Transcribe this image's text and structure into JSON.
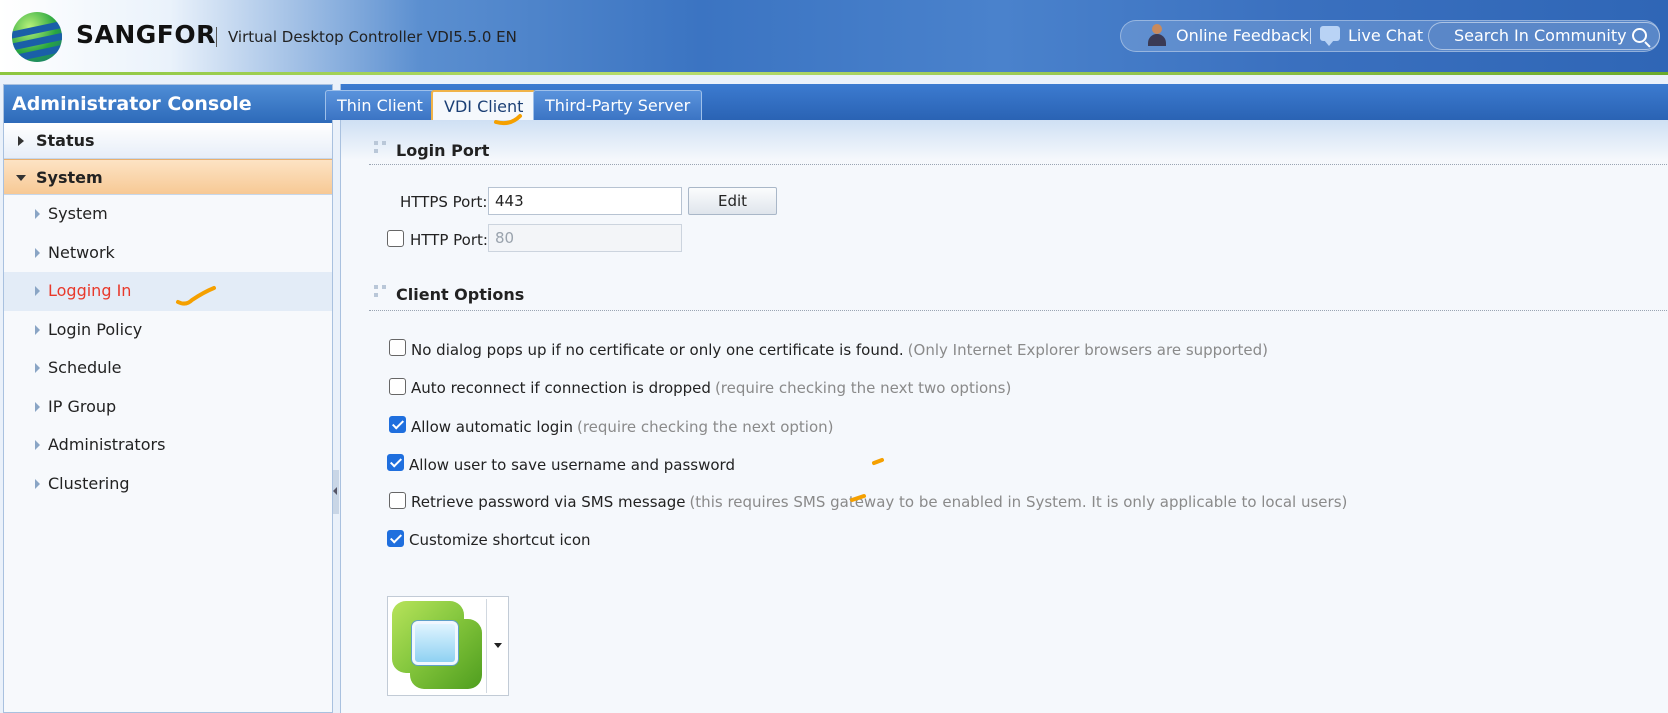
{
  "header": {
    "brand": "SANGFOR",
    "product": "Virtual Desktop Controller VDI5.5.0 EN",
    "links": {
      "online_feedback": "Online Feedback",
      "live_chat": "Live Chat",
      "search_community": "Search In Community"
    }
  },
  "sidebar": {
    "title": "Administrator Console",
    "sections": {
      "status": "Status",
      "system": "System"
    },
    "items": [
      "System",
      "Network",
      "Logging In",
      "Login Policy",
      "Schedule",
      "IP Group",
      "Administrators",
      "Clustering"
    ],
    "active_item": "Logging In"
  },
  "tabs": [
    "Thin Client",
    "VDI Client",
    "Third-Party Server"
  ],
  "active_tab": "VDI Client",
  "login_port": {
    "title": "Login Port",
    "https_label": "HTTPS Port:",
    "https_value": "443",
    "edit_label": "Edit",
    "http_label": "HTTP Port:",
    "http_value": "80",
    "http_checked": false
  },
  "client_options": {
    "title": "Client Options",
    "options": [
      {
        "label": "No dialog pops up if no certificate or only one certificate is found.",
        "hint": "(Only Internet Explorer browsers are supported)",
        "checked": false
      },
      {
        "label": "Auto reconnect if connection is dropped",
        "hint": "(require checking the next two options)",
        "checked": false
      },
      {
        "label": "Allow automatic login",
        "hint": "(require checking the next option)",
        "checked": true
      },
      {
        "label": "Allow user to save username and password",
        "hint": "",
        "checked": true
      },
      {
        "label": "Retrieve password via SMS message",
        "hint": "(this requires SMS gateway to be enabled in System. It is only applicable to local users)",
        "checked": false
      },
      {
        "label": "Customize shortcut icon",
        "hint": "",
        "checked": true
      }
    ]
  },
  "colors": {
    "accent": "#2d6ab9",
    "active_item": "#e8392b",
    "annotation": "#f5a000",
    "checkbox": "#1f6fde"
  }
}
